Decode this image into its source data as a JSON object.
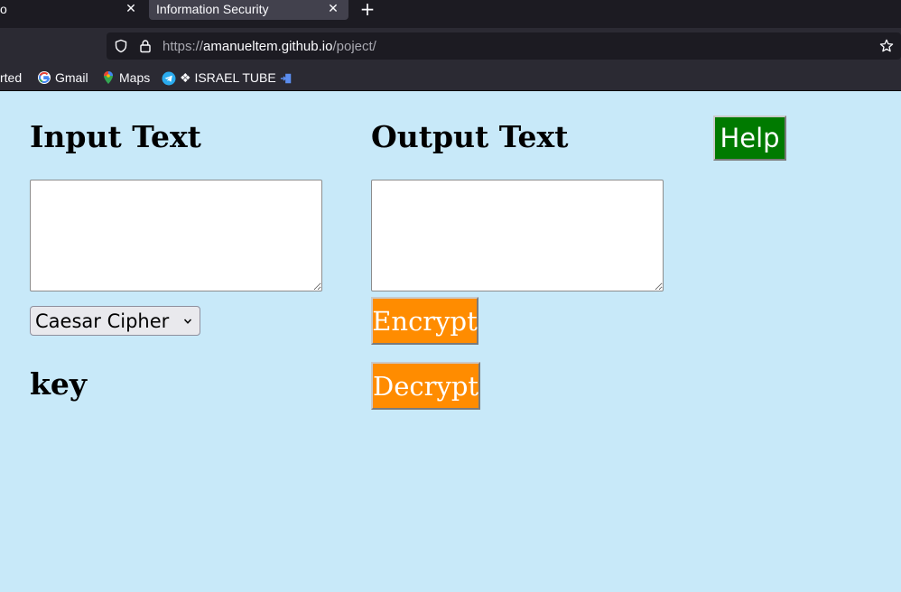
{
  "browser": {
    "tabs": [
      {
        "title": "o",
        "active": false
      },
      {
        "title": "Information Security",
        "active": true
      }
    ],
    "new_tab_label": "+",
    "url": {
      "scheme": "https://",
      "host": "amanueltem.github.io",
      "path": "/poject/"
    },
    "bookmarks": [
      {
        "label": "rted",
        "icon": "firefox-icon"
      },
      {
        "label": "Gmail",
        "icon": "google-icon"
      },
      {
        "label": "Maps",
        "icon": "maps-pin-icon"
      },
      {
        "label": "❖ ISRAEL TUBE",
        "icon": "telegram-icon"
      }
    ]
  },
  "page": {
    "input_heading": "Input Text",
    "output_heading": "Output Text",
    "help_label": "Help",
    "cipher_select": {
      "selected": "Caesar Cipher"
    },
    "key_heading": "key",
    "encrypt_label": "Encrypt",
    "decrypt_label": "Decrypt",
    "input_value": "",
    "output_value": ""
  },
  "colors": {
    "page_background": "#c8e9f9",
    "help_button": "#007a00",
    "action_buttons": "#ff8c00"
  }
}
